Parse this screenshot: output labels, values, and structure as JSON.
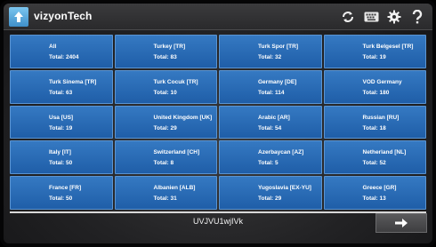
{
  "header": {
    "title": "vizyonTech",
    "icons": [
      "back-arrow-icon",
      "refresh-icon",
      "keyboard-icon",
      "settings-icon",
      "help-icon"
    ]
  },
  "tiles": [
    {
      "name": "All",
      "total": "Total: 2404"
    },
    {
      "name": "Turkey [TR]",
      "total": "Total: 83"
    },
    {
      "name": "Turk Spor [TR]",
      "total": "Total: 32"
    },
    {
      "name": "Turk Belgesel [TR]",
      "total": "Total: 19"
    },
    {
      "name": "Turk Sinema [TR]",
      "total": "Total: 63"
    },
    {
      "name": "Turk Cocuk [TR]",
      "total": "Total: 10"
    },
    {
      "name": "Germany [DE]",
      "total": "Total: 114"
    },
    {
      "name": "VOD Germany",
      "total": "Total: 180"
    },
    {
      "name": "Usa [US]",
      "total": "Total: 19"
    },
    {
      "name": "United Kingdom [UK]",
      "total": "Total: 29"
    },
    {
      "name": "Arabic [AR]",
      "total": "Total: 54"
    },
    {
      "name": "Russian [RU]",
      "total": "Total: 18"
    },
    {
      "name": "Italy [IT]",
      "total": "Total: 50"
    },
    {
      "name": "Switzerland [CH]",
      "total": "Total: 8"
    },
    {
      "name": "Azerbaycan [AZ]",
      "total": "Total: 5"
    },
    {
      "name": "Netherland [NL]",
      "total": "Total: 52"
    },
    {
      "name": "France [FR]",
      "total": "Total: 50"
    },
    {
      "name": "Albanien [ALB]",
      "total": "Total: 31"
    },
    {
      "name": "Yugoslavia [EX-YU]",
      "total": "Total: 29"
    },
    {
      "name": "Greece [GR]",
      "total": "Total: 13"
    }
  ],
  "footer": {
    "code": "UVJVU1wjIVk",
    "next_icon": "arrow-right-icon"
  },
  "colors": {
    "tile": "#2a6bb6",
    "tile_border": "#5b94d1",
    "back_button": "#5aaee0",
    "header": "#333335"
  }
}
